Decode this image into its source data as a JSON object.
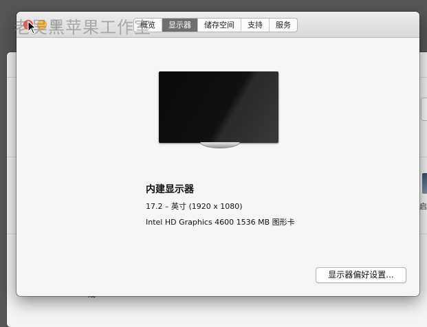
{
  "window": {
    "tabs": [
      {
        "label": "概览",
        "active": false
      },
      {
        "label": "显示器",
        "active": true
      },
      {
        "label": "储存空间",
        "active": false
      },
      {
        "label": "支持",
        "active": false
      },
      {
        "label": "服务",
        "active": false
      }
    ]
  },
  "watermark": "老吴黑苹果工作室",
  "display": {
    "name": "内建显示器",
    "size_resolution": "17.2 – 英寸 (1920 x 1080)",
    "graphics": "Intel HD Graphics 4600 1536 MB 图形卡",
    "pref_button_label": "显示器偏好设置..."
  },
  "background_window": {
    "partial_right_text": "启",
    "partial_bottom_text": "成"
  },
  "colors": {
    "close": "#fc605c",
    "minimize": "#fdbc40",
    "tab_active_bg": "#6f6f6f"
  }
}
